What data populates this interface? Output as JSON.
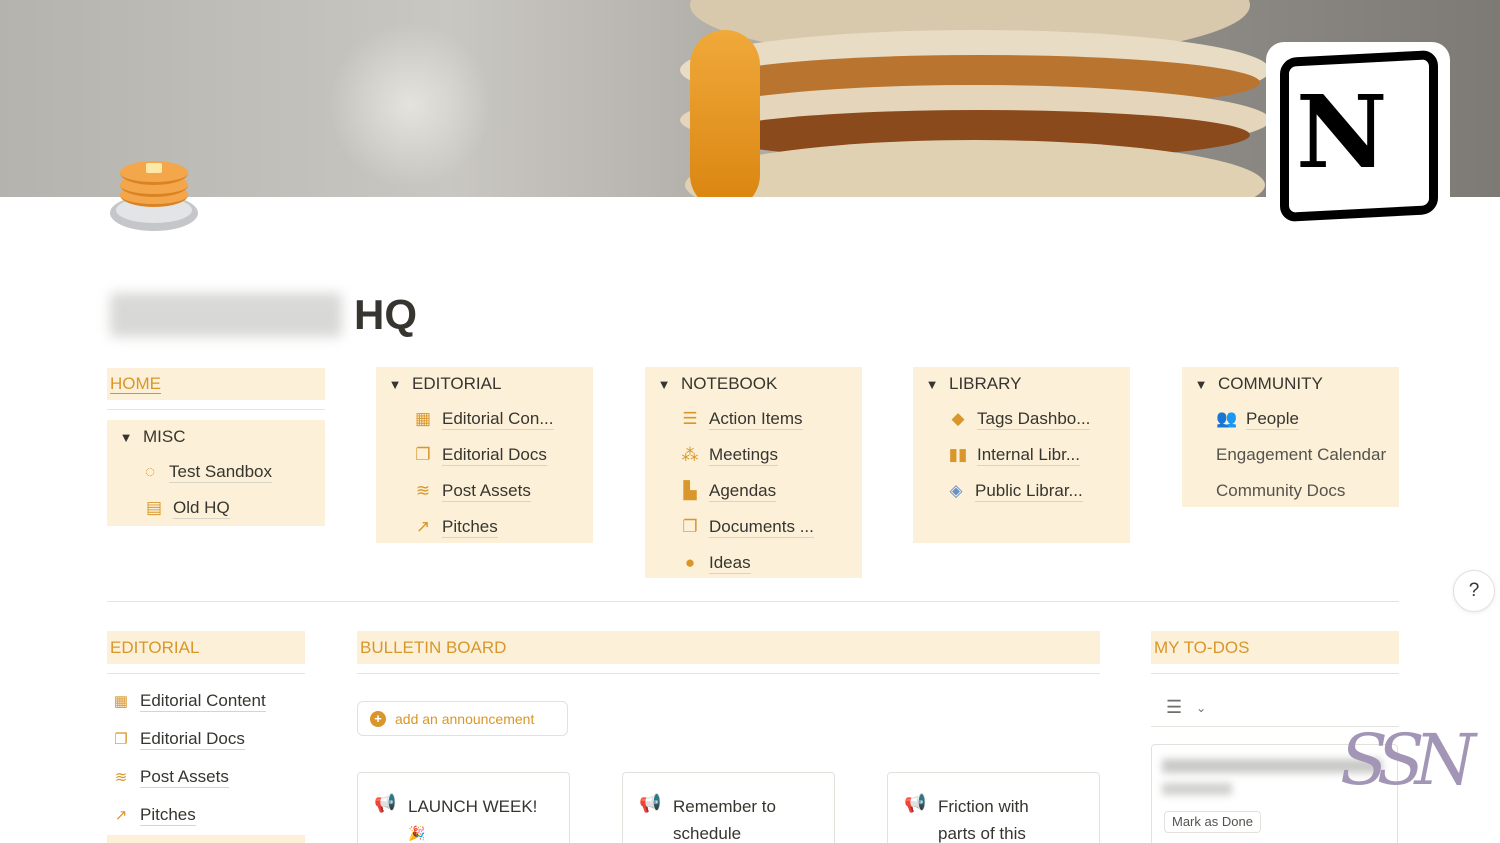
{
  "page": {
    "title_suffix": "HQ",
    "page_icon": "pancake-icon",
    "cover": "pancake-stack-photo"
  },
  "nav": {
    "home": {
      "label": "HOME"
    },
    "misc": {
      "label": "MISC",
      "items": [
        {
          "label": "Test Sandbox",
          "icon": "dashed-circle-icon"
        },
        {
          "label": "Old HQ",
          "icon": "archive-box-icon"
        }
      ]
    },
    "editorial": {
      "label": "EDITORIAL",
      "items": [
        {
          "label": "Editorial Con...",
          "icon": "calendar-icon"
        },
        {
          "label": "Editorial Docs",
          "icon": "documents-icon"
        },
        {
          "label": "Post Assets",
          "icon": "database-icon"
        },
        {
          "label": "Pitches",
          "icon": "pitch-arrow-icon"
        }
      ]
    },
    "notebook": {
      "label": "NOTEBOOK",
      "items": [
        {
          "label": "Action Items",
          "icon": "checklist-icon"
        },
        {
          "label": "Meetings",
          "icon": "people-row-icon"
        },
        {
          "label": "Agendas",
          "icon": "document-icon"
        },
        {
          "label": "Documents ...",
          "icon": "documents-icon"
        },
        {
          "label": "Ideas",
          "icon": "lightbulb-icon"
        }
      ]
    },
    "library": {
      "label": "LIBRARY",
      "items": [
        {
          "label": "Tags Dashbo...",
          "icon": "tag-icon"
        },
        {
          "label": "Internal Libr...",
          "icon": "open-book-icon"
        },
        {
          "label": "Public Librar...",
          "icon": "books-icon"
        }
      ]
    },
    "community": {
      "label": "COMMUNITY",
      "items": [
        {
          "label": "People",
          "icon": "people-icon"
        },
        {
          "label": "Engagement Calendar",
          "icon": ""
        },
        {
          "label": "Community Docs",
          "icon": ""
        }
      ]
    }
  },
  "editorial_section": {
    "header": "EDITORIAL",
    "links": [
      {
        "label": "Editorial Content",
        "icon": "calendar-link-icon"
      },
      {
        "label": "Editorial Docs",
        "icon": "documents-link-icon"
      },
      {
        "label": "Post Assets",
        "icon": "database-link-icon"
      },
      {
        "label": "Pitches",
        "icon": "pitch-link-icon"
      }
    ]
  },
  "bulletin": {
    "header": "BULLETIN BOARD",
    "add_label": "add an announcement",
    "cards": [
      {
        "text_line1": "LAUNCH WEEK!",
        "text_line2": "🎉",
        "icon": "megaphone-icon"
      },
      {
        "text_line1": "Remember to",
        "text_line2": "schedule",
        "icon": "megaphone-icon"
      },
      {
        "text_line1": "Friction with",
        "text_line2": "parts of this",
        "icon": "megaphone-icon"
      }
    ]
  },
  "todos": {
    "header": "MY TO-DOS",
    "mark_done_label": "Mark as Done"
  },
  "help": {
    "label": "?"
  },
  "colors": {
    "accent": "#d9962a",
    "block_bg": "#fcf1d8",
    "text": "#37352f"
  }
}
